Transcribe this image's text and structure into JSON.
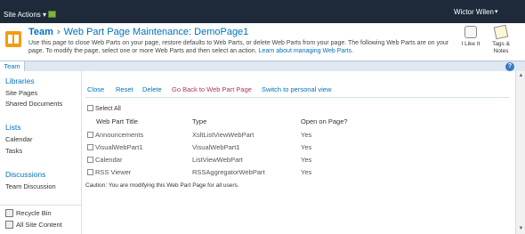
{
  "topbar": {
    "site_actions": "Site Actions ▾",
    "user": "Wictor Wilen",
    "user_caret": "▾",
    "help": "?"
  },
  "title": {
    "site": "Team",
    "separator": "›",
    "page": "Web Part Page Maintenance: DemoPage1",
    "description": "Use this page to close Web Parts on your page, restore defaults to Web Parts, or delete Web Parts from your page. The following Web Parts are on your page. To modify the page, select one or more Web Parts and then select an action.",
    "learn_link": "Learn about managing Web Parts."
  },
  "social": {
    "like": "I Like It",
    "tags": "Tags & Notes"
  },
  "tabs": {
    "team": "Team",
    "help": "?"
  },
  "nav": {
    "libraries": "Libraries",
    "site_pages": "Site Pages",
    "shared_documents": "Shared Documents",
    "lists": "Lists",
    "calendar": "Calendar",
    "tasks": "Tasks",
    "discussions": "Discussions",
    "team_discussion": "Team Discussion",
    "recycle_bin": "Recycle Bin",
    "all_site_content": "All Site Content"
  },
  "actions": {
    "close": "Close",
    "reset": "Reset",
    "delete": "Delete",
    "go_back": "Go Back to Web Part Page",
    "switch": "Switch to personal view"
  },
  "table": {
    "select_all": "Select All",
    "headers": {
      "title": "Web Part Title",
      "type": "Type",
      "open": "Open on Page?"
    },
    "rows": [
      {
        "title": "Announcements",
        "type": "XsltListViewWebPart",
        "open": "Yes"
      },
      {
        "title": "VisualWebPart1",
        "type": "VisualWebPart1",
        "open": "Yes"
      },
      {
        "title": "Calendar",
        "type": "ListViewWebPart",
        "open": "Yes"
      },
      {
        "title": "RSS Viewer",
        "type": "RSSAggregatorWebPart",
        "open": "Yes"
      }
    ],
    "caution": "Caution: You are modifying this Web Part Page for all users."
  },
  "colors": {
    "ribbon": "#1e2a3a",
    "link": "#0072bc",
    "accent": "#b03060",
    "site_icon": "#f39c12"
  }
}
